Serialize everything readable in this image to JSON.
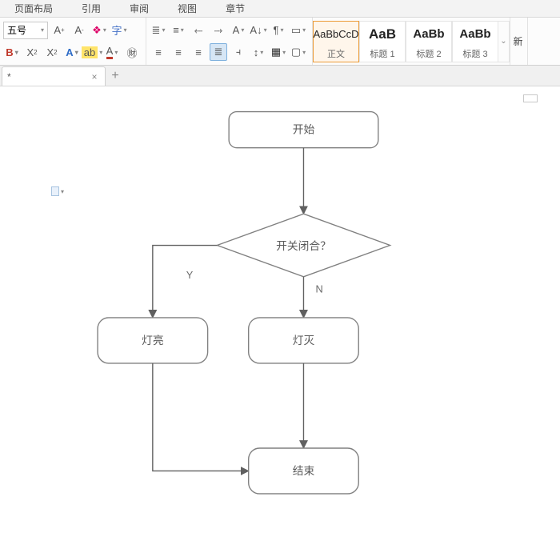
{
  "menu": {
    "items": [
      "页面布局",
      "引用",
      "审阅",
      "视图",
      "章节"
    ]
  },
  "ribbon": {
    "font_size": "五号",
    "styles": [
      {
        "preview": "AaBbCcD",
        "label": "正文"
      },
      {
        "preview": "AaB",
        "label": "标题 1"
      },
      {
        "preview": "AaBb",
        "label": "标题 2"
      },
      {
        "preview": "AaBb",
        "label": "标题 3"
      }
    ],
    "new_style_label": "新"
  },
  "tab": {
    "title": "*",
    "add_tooltip": "+"
  },
  "flowchart": {
    "nodes": {
      "start": "开始",
      "decision": "开关闭合？",
      "yes": "灯亮",
      "no": "灯灭",
      "end": "结束"
    },
    "edges": {
      "yes_label": "Y",
      "no_label": "N"
    }
  }
}
